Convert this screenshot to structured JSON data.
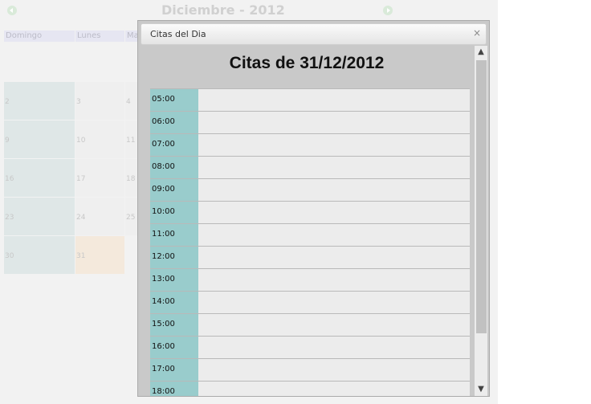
{
  "calendar": {
    "title": "Diciembre - 2012",
    "day_headers": [
      "Domingo",
      "Lunes",
      "Martes"
    ],
    "rows": [
      [
        "2",
        "3",
        "4"
      ],
      [
        "9",
        "10",
        "11"
      ],
      [
        "16",
        "17",
        "18"
      ],
      [
        "23",
        "24",
        "25"
      ],
      [
        "30",
        "31"
      ]
    ]
  },
  "modal": {
    "title": "Citas del Dia",
    "close_icon": "×",
    "heading": "Citas de 31/12/2012",
    "slots": [
      "05:00",
      "06:00",
      "07:00",
      "08:00",
      "09:00",
      "10:00",
      "11:00",
      "12:00",
      "13:00",
      "14:00",
      "15:00",
      "16:00",
      "17:00",
      "18:00"
    ]
  },
  "colors": {
    "time_cell": "#99cccc",
    "today_cell": "#f4e9dc",
    "sunday_cell": "#dfe7e7"
  },
  "icons": {
    "prev": "circle-arrow-left-icon",
    "next": "circle-arrow-right-icon",
    "close": "close-icon",
    "scroll_up": "chevron-up-icon",
    "scroll_down": "chevron-down-icon"
  }
}
